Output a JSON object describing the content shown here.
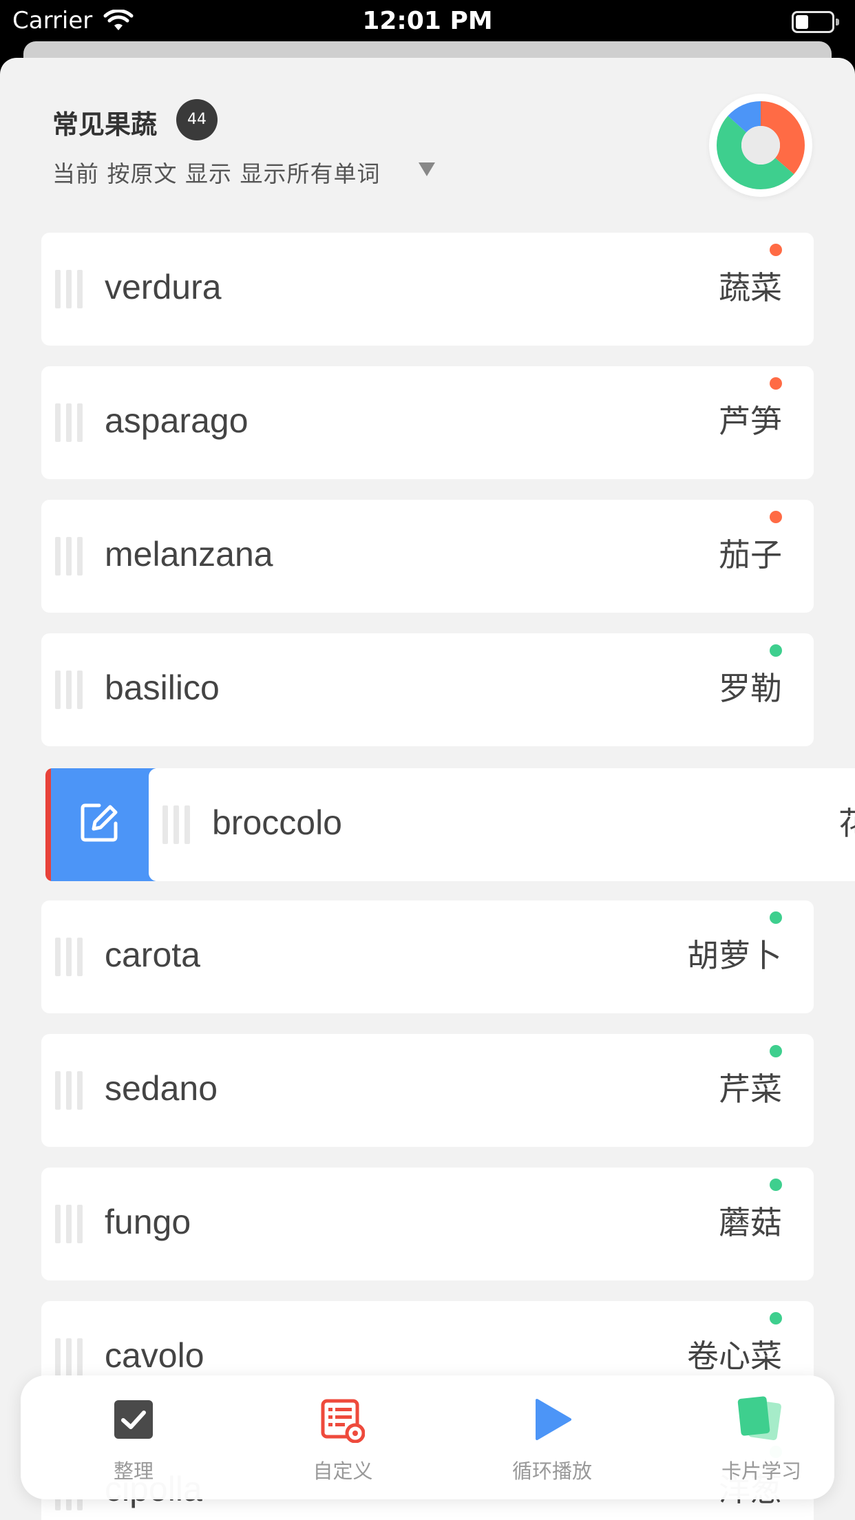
{
  "status_bar": {
    "carrier": "Carrier",
    "time": "12:01 PM"
  },
  "header": {
    "title": "常见果蔬",
    "count": "44",
    "subtitle": "当前 按原文 显示 显示所有单词",
    "progress_colors": [
      "#ff6b45",
      "#3ecf8e",
      "#4c95f7"
    ]
  },
  "colors": {
    "red_dot": "#ff6b45",
    "green_dot": "#3ecf8e",
    "edit_blue": "#4c95f7",
    "delete_red": "#e8423a"
  },
  "words": [
    {
      "word": "verdura",
      "translation": "蔬菜",
      "status": "red"
    },
    {
      "word": "asparago",
      "translation": "芦笋",
      "status": "red"
    },
    {
      "word": "melanzana",
      "translation": "茄子",
      "status": "red"
    },
    {
      "word": "basilico",
      "translation": "罗勒",
      "status": "green"
    },
    {
      "word": "broccolo",
      "translation": "花",
      "status": "swiped"
    },
    {
      "word": "carota",
      "translation": "胡萝卜",
      "status": "green"
    },
    {
      "word": "sedano",
      "translation": "芹菜",
      "status": "green"
    },
    {
      "word": "fungo",
      "translation": "蘑菇",
      "status": "green"
    },
    {
      "word": "cavolo",
      "translation": "卷心菜",
      "status": "green"
    },
    {
      "word": "cipolla",
      "translation": "洋葱",
      "status": "green"
    }
  ],
  "toolbar": {
    "organize_label": "整理",
    "custom_label": "自定义",
    "loop_play_label": "循环播放",
    "flashcard_label": "卡片学习"
  }
}
